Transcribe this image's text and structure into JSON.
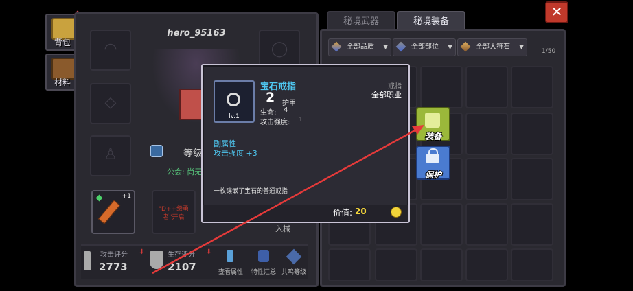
{
  "player": {
    "name": "hero_95163",
    "level_text": "等级",
    "guild_text": "公会: 尚无"
  },
  "sidetabs": {
    "backpack": "背包",
    "materials": "材料"
  },
  "weapon_slot": {
    "badge": "+1"
  },
  "locked_slot": {
    "text": "\"D++级勇者\"开启"
  },
  "stats": {
    "attack_label": "攻击评分",
    "attack_value": "2773",
    "survival_label": "生存评分",
    "survival_value": "2107",
    "view_attrs": "查看属性",
    "traits": "特性汇总",
    "resonance": "共鸣等级"
  },
  "hidden_button_fragment": "入械",
  "tabs": {
    "secret_weapon": "秘境武器",
    "secret_equip": "秘境装备"
  },
  "filters": {
    "quality": "全部品质",
    "slot": "全部部位",
    "gem": "全部大符石",
    "count": "1/50"
  },
  "tooltip": {
    "item_name": "宝石戒指",
    "item_level": "lv.1",
    "armor_value": "2",
    "armor_label": "护甲",
    "hp_label": "生命:",
    "hp_value": "4",
    "atk_label": "攻击强度:",
    "atk_value": "1",
    "type": "戒指",
    "job": "全部职业",
    "sub_attr_title": "副属性",
    "sub_attr": "攻击强度 +3",
    "description": "一枚镶嵌了宝石的普通戒指",
    "price_label": "价值:",
    "price_value": "20"
  },
  "actions": {
    "equip": "装备",
    "protect": "保护"
  },
  "close_icon": "close-icon",
  "colors": {
    "accent_cyan": "#4fc8f2",
    "price_yellow": "#f2d43a",
    "equip_green": "#9bb83a",
    "protect_blue": "#4a7bd0",
    "close_red": "#c0392b",
    "arrow_red": "#e53a3a"
  }
}
